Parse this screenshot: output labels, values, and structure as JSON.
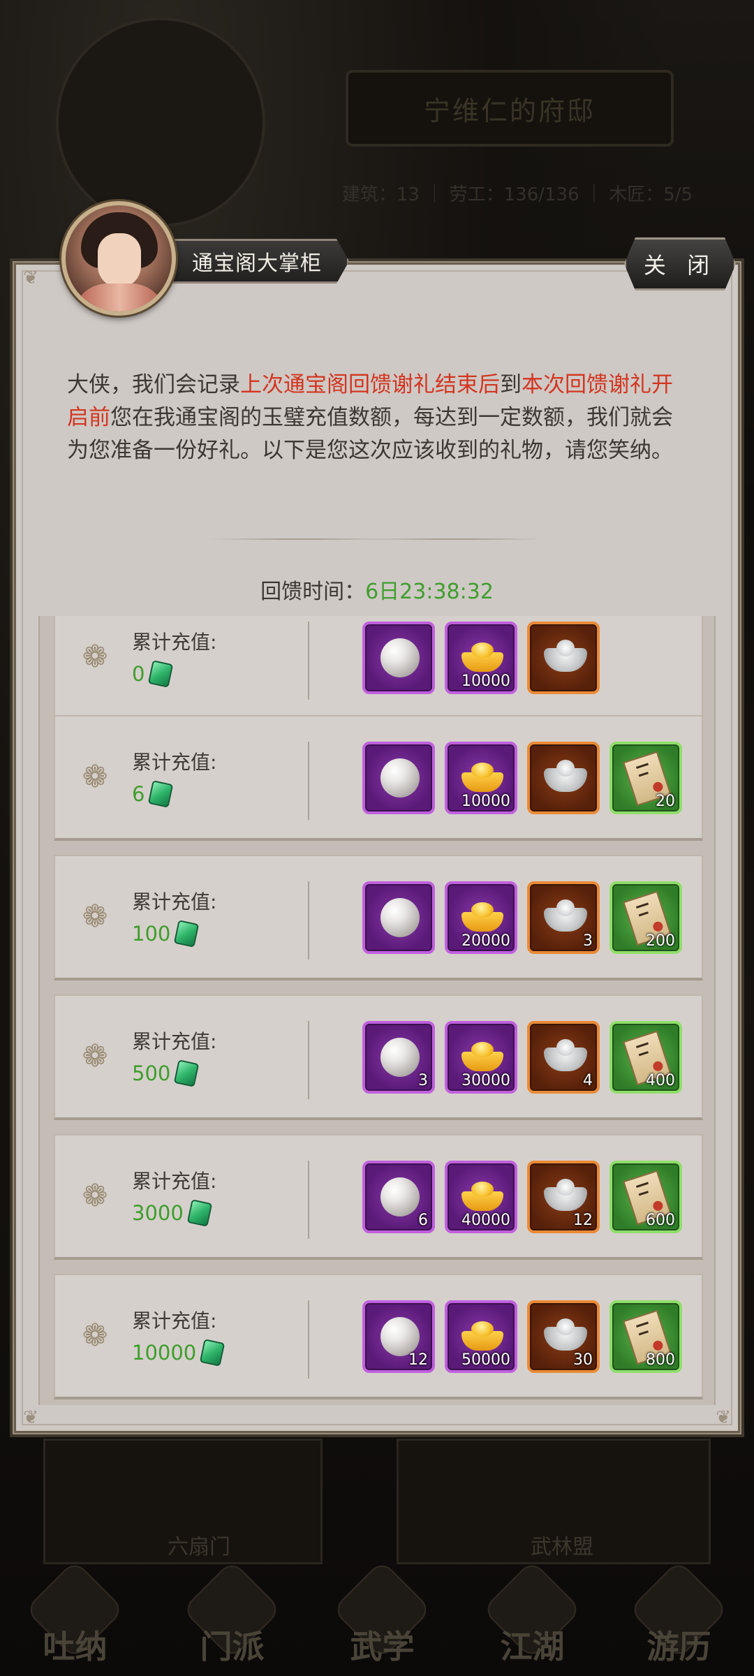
{
  "background": {
    "residence_title": "宁维仁的府邸",
    "stats": "建筑：13 ｜ 劳工：136/136 ｜ 木匠：5/5",
    "panel_labels": [
      "六扇门",
      "武林盟"
    ],
    "nav": [
      "吐纳",
      "门派",
      "武学",
      "江湖",
      "游历"
    ]
  },
  "dialog": {
    "speaker": "通宝阁大掌柜",
    "close_label": "关 闭",
    "intro_parts": [
      {
        "text": "大侠，我们会记录",
        "highlight": false
      },
      {
        "text": "上次通宝阁回馈谢礼结束后",
        "highlight": true
      },
      {
        "text": "到",
        "highlight": false
      },
      {
        "text": "本次回馈谢礼开启前",
        "highlight": true
      },
      {
        "text": "您在我通宝阁的玉璧充值数额，每达到一定数额，我们就会为您准备一份好礼。以下是您这次应该收到的礼物，请您笑纳。",
        "highlight": false
      }
    ],
    "timer_label": "回馈时间：",
    "timer_value": "6日23:38:32",
    "tiers": [
      {
        "label": "累计充值:",
        "amount": "0",
        "items": [
          {
            "icon": "pearl-icon",
            "rarity": "purple",
            "count": ""
          },
          {
            "icon": "gold-ingot-icon",
            "rarity": "purple",
            "count": "10000"
          },
          {
            "icon": "silver-ingot-icon",
            "rarity": "orange",
            "count": ""
          }
        ]
      },
      {
        "label": "累计充值:",
        "amount": "6",
        "items": [
          {
            "icon": "pearl-icon",
            "rarity": "purple",
            "count": ""
          },
          {
            "icon": "gold-ingot-icon",
            "rarity": "purple",
            "count": "10000"
          },
          {
            "icon": "silver-ingot-icon",
            "rarity": "orange",
            "count": ""
          },
          {
            "icon": "letter-icon",
            "rarity": "green",
            "count": "20"
          }
        ]
      },
      {
        "label": "累计充值:",
        "amount": "100",
        "items": [
          {
            "icon": "pearl-icon",
            "rarity": "purple",
            "count": ""
          },
          {
            "icon": "gold-ingot-icon",
            "rarity": "purple",
            "count": "20000"
          },
          {
            "icon": "silver-ingot-icon",
            "rarity": "orange",
            "count": "3"
          },
          {
            "icon": "letter-icon",
            "rarity": "green",
            "count": "200"
          }
        ]
      },
      {
        "label": "累计充值:",
        "amount": "500",
        "items": [
          {
            "icon": "pearl-icon",
            "rarity": "purple",
            "count": "3"
          },
          {
            "icon": "gold-ingot-icon",
            "rarity": "purple",
            "count": "30000"
          },
          {
            "icon": "silver-ingot-icon",
            "rarity": "orange",
            "count": "4"
          },
          {
            "icon": "letter-icon",
            "rarity": "green",
            "count": "400"
          }
        ]
      },
      {
        "label": "累计充值:",
        "amount": "3000",
        "items": [
          {
            "icon": "pearl-icon",
            "rarity": "purple",
            "count": "6"
          },
          {
            "icon": "gold-ingot-icon",
            "rarity": "purple",
            "count": "40000"
          },
          {
            "icon": "silver-ingot-icon",
            "rarity": "orange",
            "count": "12"
          },
          {
            "icon": "letter-icon",
            "rarity": "green",
            "count": "600"
          }
        ]
      },
      {
        "label": "累计充值:",
        "amount": "10000",
        "items": [
          {
            "icon": "pearl-icon",
            "rarity": "purple",
            "count": "12"
          },
          {
            "icon": "gold-ingot-icon",
            "rarity": "purple",
            "count": "50000"
          },
          {
            "icon": "silver-ingot-icon",
            "rarity": "orange",
            "count": "30"
          },
          {
            "icon": "letter-icon",
            "rarity": "green",
            "count": "800"
          }
        ]
      }
    ]
  },
  "colors": {
    "highlight_red": "#d33520",
    "value_green": "#3e9e2c",
    "rarity_purple": "#c060de",
    "rarity_orange": "#e98a36",
    "rarity_green": "#8fde6a"
  }
}
